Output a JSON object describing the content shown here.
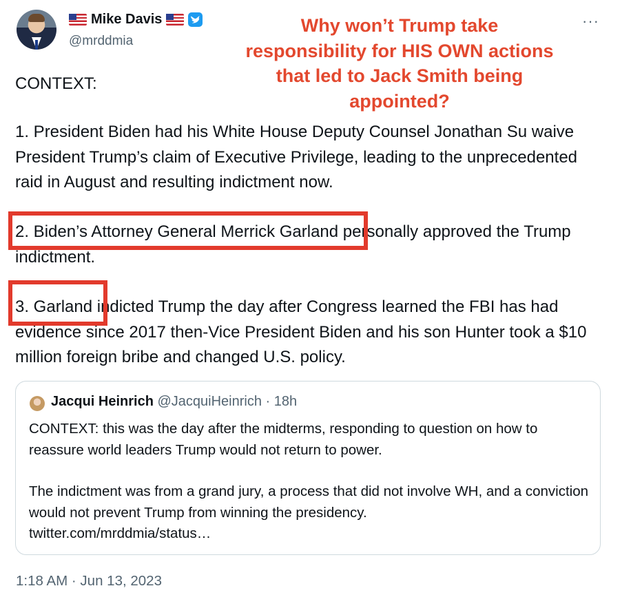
{
  "header": {
    "display_name": "Mike Davis",
    "handle": "@mrddmia",
    "flag_icon": "us-flag-icon",
    "verified_icon": "verified-badge-icon",
    "more_label": "···"
  },
  "overlay_caption": {
    "lines": [
      "Why won’t Trump take",
      "responsibility for HIS OWN actions",
      "that led to Jack Smith being",
      "appointed?"
    ],
    "color": "#e3482e"
  },
  "tweet": {
    "intro": "CONTEXT:",
    "point1": "1. President Biden had his White House Deputy Counsel Jonathan Su waive President Trump’s claim of Executive Privilege, leading to the unprecedented raid in August and resulting indictment now.",
    "point2": "2. Biden’s Attorney General Merrick Garland personally approved the Trump indictment.",
    "point3": "3. Garland indicted Trump the day after Congress learned the FBI has had evidence since 2017 then-Vice President Biden and his son Hunter took a $10 million foreign bribe and changed U.S. policy."
  },
  "quoted_tweet": {
    "name": "Jacqui Heinrich",
    "handle_time": "@JacquiHeinrich · 18h",
    "para1": "CONTEXT: this was the day after the midterms, responding to question on how to reassure world leaders Trump would not return to power.",
    "para2": "The indictment was from a grand jury, a process that did not involve WH, and a conviction would not prevent Trump from winning the presidency.",
    "link": "twitter.com/mrddmia/status…"
  },
  "timestamp": "1:18 AM · Jun 13, 2023",
  "colors": {
    "highlight_box": "#e23a2c",
    "verified": "#1d9bf0",
    "muted_text": "#536471"
  }
}
